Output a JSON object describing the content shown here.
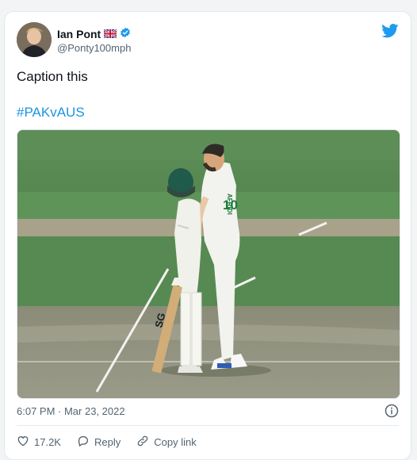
{
  "tweet": {
    "author_name": "Ian Pont",
    "author_handle": "@Ponty100mph",
    "text": "Caption this",
    "hashtag": "#PAKvAUS",
    "timestamp": "6:07 PM · Mar 23, 2022",
    "like_count": "17.2K",
    "reply_label": "Reply",
    "copy_link_label": "Copy link"
  },
  "media": {
    "jersey_name": "AFRIDI",
    "jersey_number": "10"
  },
  "colors": {
    "link_blue": "#1b95e0",
    "verified_blue": "#1d9bf0",
    "muted_text": "#536471"
  },
  "icons": [
    "avatar",
    "uk-flag-icon",
    "verified-badge-icon",
    "twitter-bird-icon",
    "info-icon",
    "heart-icon",
    "reply-icon",
    "copy-link-icon"
  ]
}
